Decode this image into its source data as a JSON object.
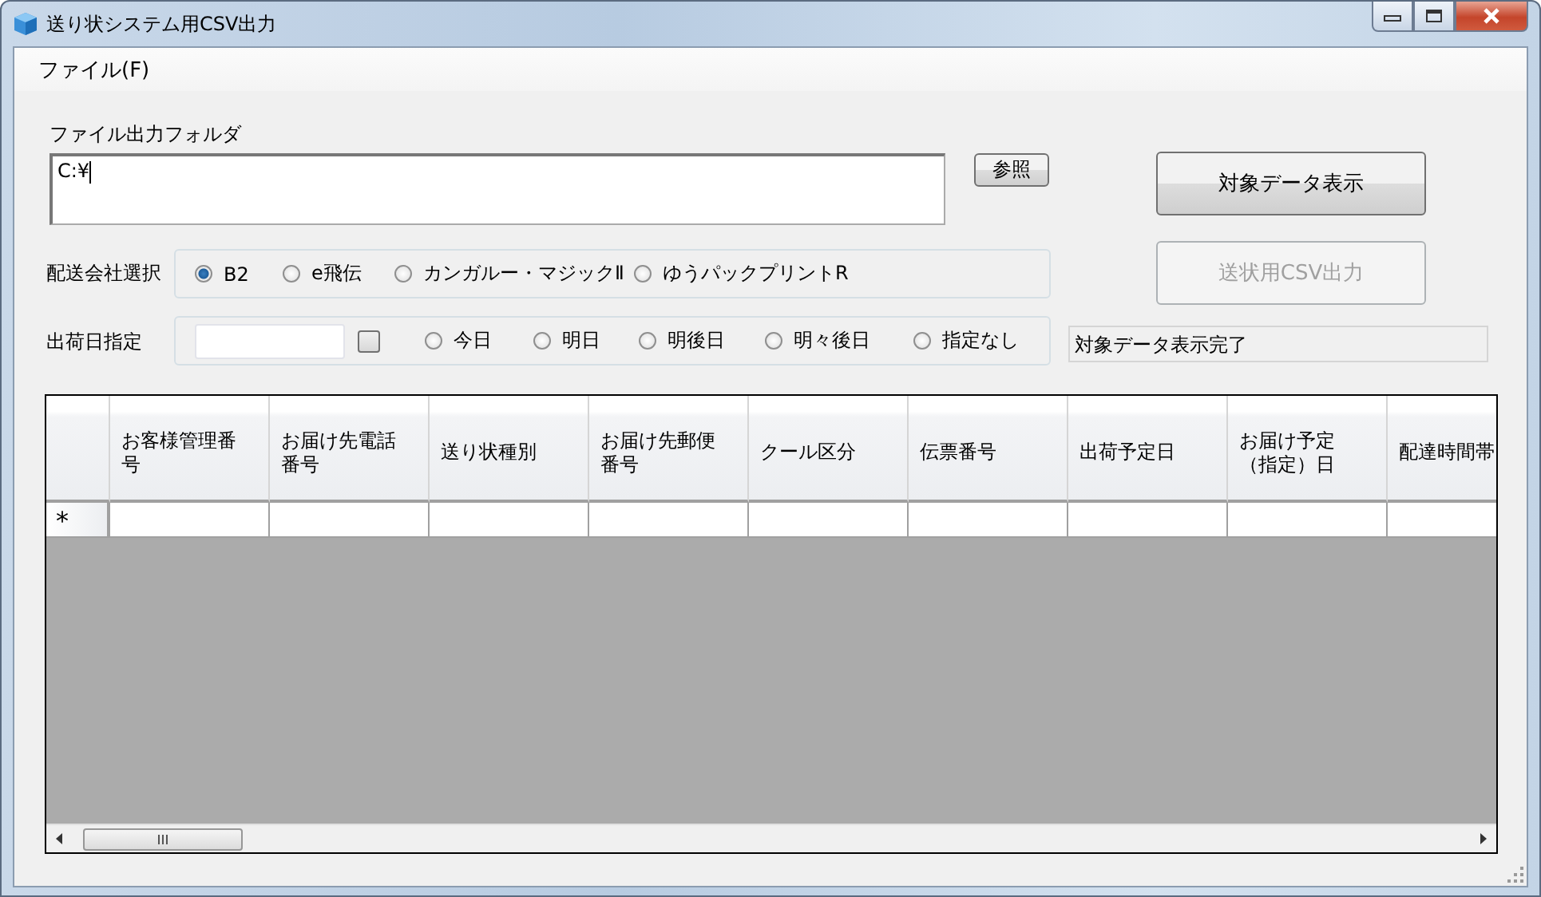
{
  "window": {
    "title": "送り状システム用CSV出力"
  },
  "menu": [
    {
      "label": "ファイル(F)"
    }
  ],
  "output_folder": {
    "label": "ファイル出力フォルダ",
    "value": "C:¥"
  },
  "browse_button": {
    "label": "参照"
  },
  "show_data_button": {
    "label": "対象データ表示",
    "disabled": false
  },
  "csv_export_button": {
    "label": "送状用CSV出力",
    "disabled": true
  },
  "carrier": {
    "label": "配送会社選択",
    "options": [
      {
        "label": "B2",
        "selected": true
      },
      {
        "label": "e飛伝",
        "selected": false
      },
      {
        "label": "カンガルー・マジックⅡ",
        "selected": false
      },
      {
        "label": "ゆうパックプリントR",
        "selected": false
      }
    ]
  },
  "ship_date": {
    "label": "出荷日指定",
    "checkbox": {
      "checked": false
    },
    "options": [
      {
        "label": "今日",
        "selected": false
      },
      {
        "label": "明日",
        "selected": false
      },
      {
        "label": "明後日",
        "selected": false
      },
      {
        "label": "明々後日",
        "selected": false
      },
      {
        "label": "指定なし",
        "selected": false
      }
    ]
  },
  "status": {
    "value": "対象データ表示完了"
  },
  "table": {
    "columns": [
      "お客様管理番号",
      "お届け先電話番号",
      "送り状種別",
      "お届け先郵便番号",
      "クール区分",
      "伝票番号",
      "出荷予定日",
      "お届け予定（指定）日",
      "配達時間帯"
    ],
    "new_row_marker": "*"
  }
}
